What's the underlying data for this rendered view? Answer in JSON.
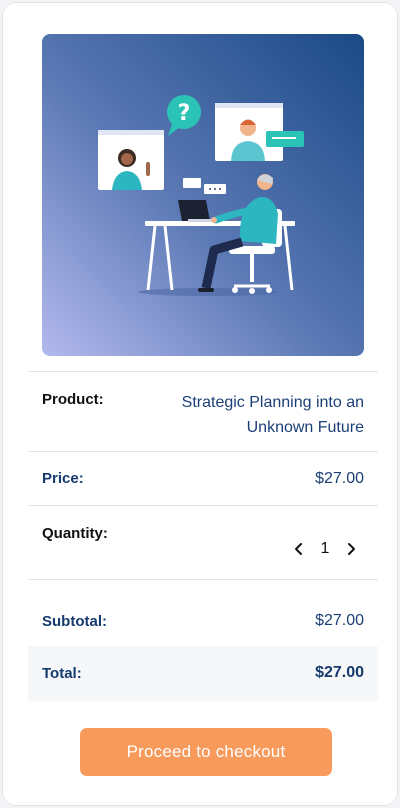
{
  "cart": {
    "product_label": "Product:",
    "product_name": "Strategic Planning into an Unknown Future",
    "price_label": "Price:",
    "price_value": "$27.00",
    "quantity_label": "Quantity:",
    "quantity_value": "1",
    "decrease_icon": "chevron-left-icon",
    "increase_icon": "chevron-right-icon",
    "subtotal_label": "Subtotal:",
    "subtotal_value": "$27.00",
    "total_label": "Total:",
    "total_value": "$27.00",
    "checkout_label": "Proceed to checkout"
  },
  "colors": {
    "accent_button": "#f79a5b",
    "value_text": "#1c3f77",
    "hero_gradient_top": "#1f4f88",
    "hero_gradient_bottom": "#a9b3ea"
  }
}
